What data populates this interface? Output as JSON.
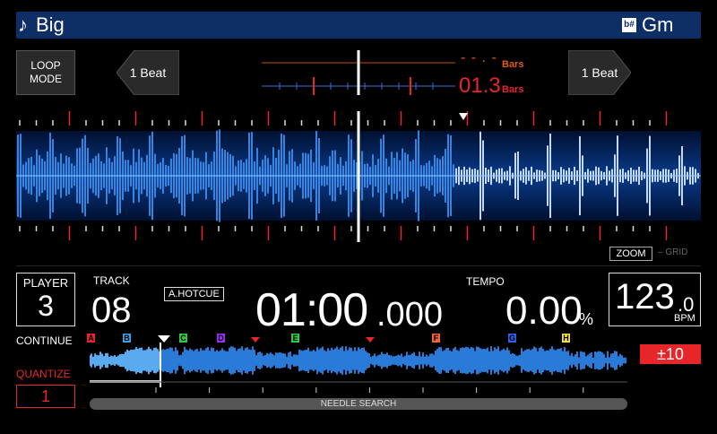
{
  "header": {
    "title": "Big",
    "note_icon": "music-note-icon",
    "key_badge": "b#",
    "key": "Gm",
    "bar_color": "#0e2f66"
  },
  "loop_mode": {
    "label_line1": "LOOP",
    "label_line2": "MODE"
  },
  "beat_left": {
    "label": "1 Beat"
  },
  "beat_right": {
    "label": "1 Beat"
  },
  "bars": {
    "top_value": "- - . -",
    "top_unit": "Bars",
    "bottom_value": "01.3",
    "bottom_unit": "Bars"
  },
  "zoom": {
    "label": "ZOOM",
    "grid_label": "GRID"
  },
  "player": {
    "label": "PLAYER",
    "number": "3"
  },
  "track": {
    "label": "TRACK",
    "number": "08",
    "hotcue": "A.HOTCUE"
  },
  "time": {
    "main": "01:00",
    "ms": ".000"
  },
  "tempo": {
    "label": "TEMPO",
    "value": "0.00",
    "unit": "%"
  },
  "bpm": {
    "value": "123",
    "decimal": ".0",
    "unit": "BPM"
  },
  "continue": {
    "label": "CONTINUE"
  },
  "quantize": {
    "label": "QUANTIZE",
    "value": "1"
  },
  "tempo_range": {
    "label": "±10"
  },
  "needle_search": {
    "label": "NEEDLE SEARCH"
  },
  "hot_cues": [
    {
      "letter": "A",
      "color": "#e8262a"
    },
    {
      "letter": "B",
      "color": "#3aa0e8"
    },
    {
      "letter": "C",
      "color": "#2ecc40"
    },
    {
      "letter": "D",
      "color": "#9b30ff"
    },
    {
      "letter": "E",
      "color": "#2ecc40"
    },
    {
      "letter": "F",
      "color": "#f0603a"
    },
    {
      "letter": "G",
      "color": "#3060e8"
    },
    {
      "letter": "H",
      "color": "#f0e040"
    }
  ],
  "colors": {
    "accent_red": "#e8262a",
    "wave_blue": "#2f7fe0",
    "bars_orange": "#e05a1e"
  }
}
